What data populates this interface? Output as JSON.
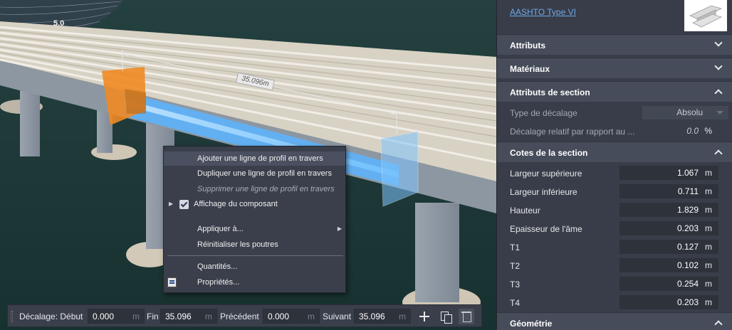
{
  "viewport": {
    "scale_label": "5.0",
    "dimension_label": "35.096m"
  },
  "context_menu": {
    "items": [
      {
        "label": "Ajouter une ligne de profil en travers",
        "state": "highlighted"
      },
      {
        "label": "Dupliquer une ligne de profil en travers",
        "state": "normal"
      },
      {
        "label": "Supprimer une ligne de profil en travers",
        "state": "disabled"
      },
      {
        "label": "Affichage du composant",
        "state": "checked"
      },
      {
        "label": "Appliquer à...",
        "state": "submenu"
      },
      {
        "label": "Réinitialiser les poutres",
        "state": "normal"
      },
      {
        "label": "Quantités...",
        "state": "normal"
      },
      {
        "label": "Propriétés...",
        "state": "normal"
      }
    ]
  },
  "bottom_bar": {
    "decalage_label": "Décalage: Début",
    "debut_value": "0.000",
    "fin_label": "Fin",
    "fin_value": "35.096",
    "precedent_label": "Précédent",
    "precedent_value": "0.000",
    "suivant_label": "Suivant",
    "suivant_value": "35.096",
    "unit": "m"
  },
  "panel": {
    "component_link": "AASHTO Type VI",
    "sections": {
      "attributs": "Attributs",
      "materiaux": "Matériaux",
      "attributs_section": "Attributs de section",
      "cotes": "Cotes de la section",
      "geometrie": "Géométrie"
    },
    "type_decalage_label": "Type de décalage",
    "type_decalage_value": "Absolu",
    "decalage_relatif_label": "Décalage relatif par rapport au ...",
    "decalage_relatif_value": "0.0",
    "decalage_relatif_unit": "%",
    "unit": "m",
    "dimensions": [
      {
        "label": "Largeur supérieure",
        "value": "1.067"
      },
      {
        "label": "Largeur inférieure",
        "value": "0.711"
      },
      {
        "label": "Hauteur",
        "value": "1.829"
      },
      {
        "label": "Epaisseur de l'âme",
        "value": "0.203"
      },
      {
        "label": "T1",
        "value": "0.127"
      },
      {
        "label": "T2",
        "value": "0.102"
      },
      {
        "label": "T3",
        "value": "0.254"
      },
      {
        "label": "T4",
        "value": "0.203"
      }
    ]
  },
  "colors": {
    "panel_bg": "#383d49",
    "section_header": "#464c59",
    "link": "#6ea8e6",
    "highlight_blue": "#5ab4ff",
    "section_orange": "#f08a24"
  }
}
